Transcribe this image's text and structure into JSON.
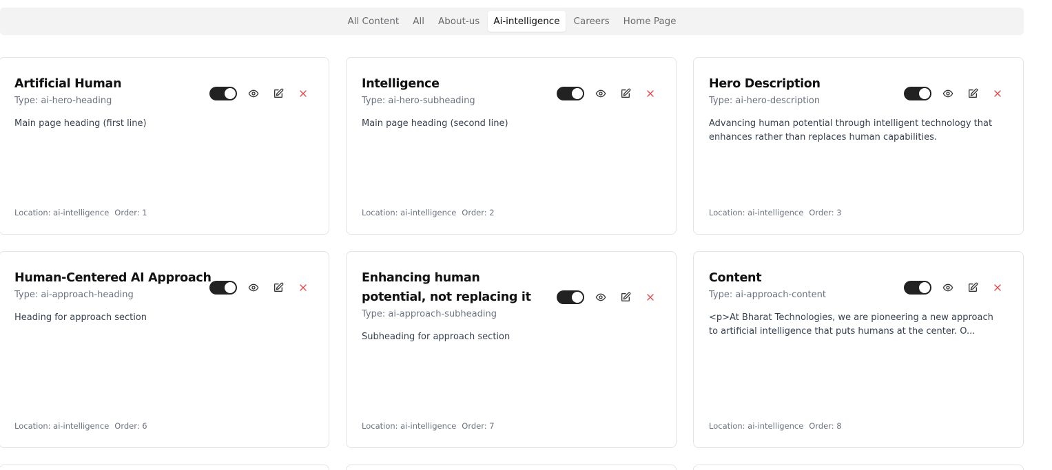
{
  "tabs": [
    {
      "label": "All Content",
      "active": false
    },
    {
      "label": "All",
      "active": false
    },
    {
      "label": "About-us",
      "active": false
    },
    {
      "label": "Ai-intelligence",
      "active": true
    },
    {
      "label": "Careers",
      "active": false
    },
    {
      "label": "Home Page",
      "active": false
    }
  ],
  "cards": [
    {
      "title": "Artificial Human",
      "type": "Type: ai-hero-heading",
      "description": "Main page heading (first line)",
      "location": "Location: ai-intelligence",
      "order": "Order: 1"
    },
    {
      "title": "Intelligence",
      "type": "Type: ai-hero-subheading",
      "description": "Main page heading (second line)",
      "location": "Location: ai-intelligence",
      "order": "Order: 2"
    },
    {
      "title": "Hero Description",
      "type": "Type: ai-hero-description",
      "description": "Advancing human potential through intelligent technology that enhances rather than replaces human capabilities.",
      "location": "Location: ai-intelligence",
      "order": "Order: 3"
    },
    {
      "title": "Human-Centered AI Approach",
      "type": "Type: ai-approach-heading",
      "description": "Heading for approach section",
      "location": "Location: ai-intelligence",
      "order": "Order: 6"
    },
    {
      "title": "Enhancing human potential, not replacing it",
      "type": "Type: ai-approach-subheading",
      "description": "Subheading for approach section",
      "location": "Location: ai-intelligence",
      "order": "Order: 7"
    },
    {
      "title": "Content",
      "type": "Type: ai-approach-content",
      "description": "<p>At Bharat Technologies, we are pioneering a new approach to artificial intelligence that puts humans at the center. O...",
      "location": "Location: ai-intelligence",
      "order": "Order: 8"
    }
  ],
  "colors": {
    "toggle_on": "#222222",
    "delete": "#e5484d",
    "tabbar_bg": "#f3f3f4"
  },
  "icons": {
    "view": "eye-icon",
    "edit": "edit-icon",
    "delete": "close-icon"
  }
}
